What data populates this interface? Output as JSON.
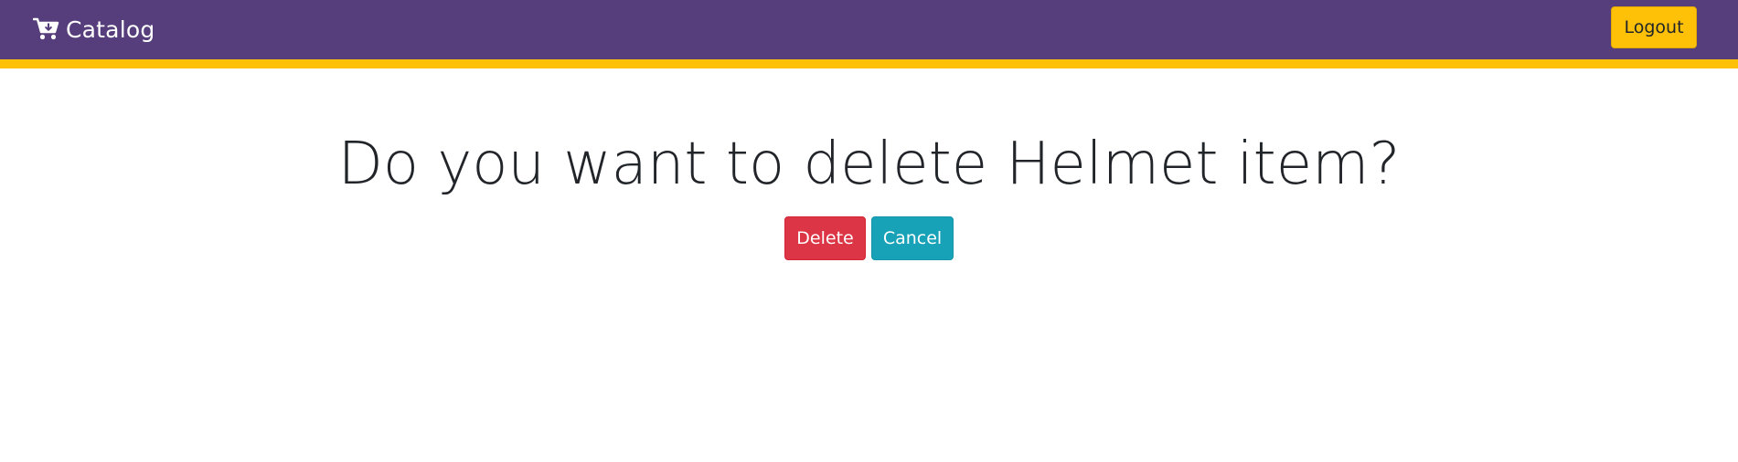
{
  "header": {
    "brand_label": "Catalog",
    "brand_icon": "cart-plus-icon",
    "logout_label": "Logout",
    "colors": {
      "navbar_bg": "#563d7c",
      "accent": "#ffc107",
      "logout_bg": "#ffc107"
    }
  },
  "main": {
    "question": "Do you want to delete Helmet item?",
    "delete_label": "Delete",
    "cancel_label": "Cancel",
    "colors": {
      "delete_bg": "#dc3545",
      "cancel_bg": "#17a2b8"
    }
  }
}
